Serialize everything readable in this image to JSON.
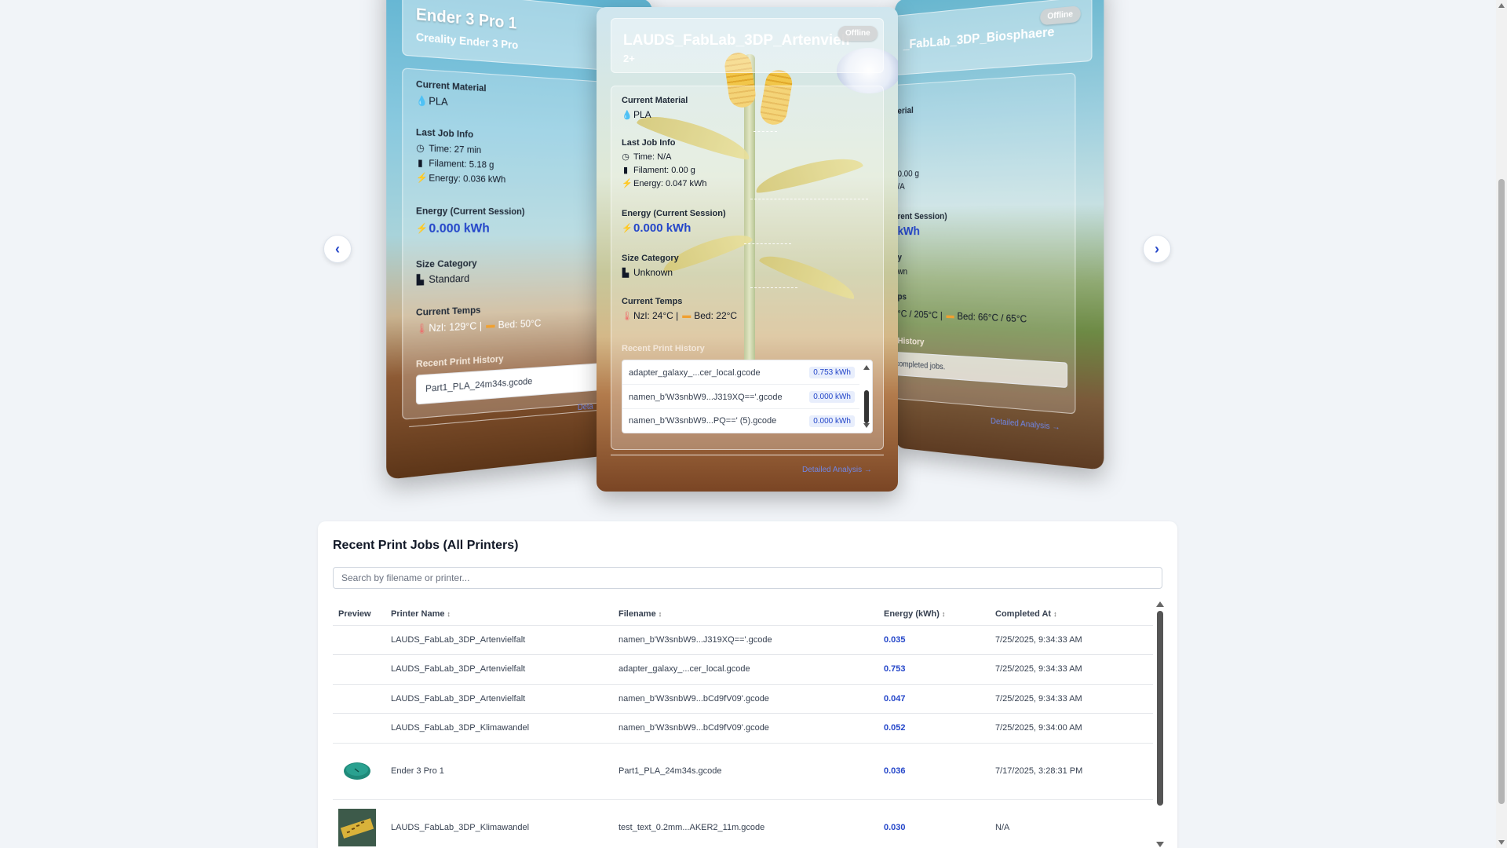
{
  "carousel": {
    "left_card": {
      "name": "Ender 3 Pro 1",
      "model": "Creality Ender 3 Pro",
      "material_label": "Current Material",
      "material": "PLA",
      "last_job_label": "Last Job Info",
      "time": "Time: 27 min",
      "filament": "Filament: 5.18 g",
      "energy": "Energy: 0.036 kWh",
      "session_label": "Energy (Current Session)",
      "session_value": "0.000 kWh",
      "size_label": "Size Category",
      "size": "Standard",
      "temps_label": "Current Temps",
      "nozzle": "Nzl: 129°C |",
      "bed": "Bed: 50°C",
      "history_label": "Recent Print History",
      "history_item": "Part1_PLA_24m34s.gcode",
      "details": "Deta"
    },
    "center_card": {
      "name": "LAUDS_FabLab_3DP_Artenvielfalt",
      "model": "2+",
      "status": "Offline",
      "material_label": "Current Material",
      "material": "PLA",
      "last_job_label": "Last Job Info",
      "time": "Time: N/A",
      "filament": "Filament: 0.00 g",
      "energy": "Energy: 0.047 kWh",
      "session_label": "Energy (Current Session)",
      "session_value": "0.000 kWh",
      "size_label": "Size Category",
      "size": "Unknown",
      "temps_label": "Current Temps",
      "nozzle": "Nzl: 24°C |",
      "bed": "Bed: 22°C",
      "history_label": "Recent Print History",
      "history": [
        {
          "file": "adapter_galaxy_...cer_local.gcode",
          "kwh": "0.753 kWh"
        },
        {
          "file": "namen_b'W3snbW9...J319XQ=='.gcode",
          "kwh": "0.000 kWh"
        },
        {
          "file": "namen_b'W3snbW9...PQ==' (5).gcode",
          "kwh": "0.000 kWh"
        }
      ],
      "details": "Detailed Analysis →"
    },
    "right_card": {
      "name": "_FabLab_3DP_Biosphaere",
      "status": "Offline",
      "material_label": "erial",
      "filament": "0.00 g",
      "energy": "/A",
      "session_label": "rent Session)",
      "session_value": "kWh",
      "size_label": "y",
      "size": "wn",
      "temps_label": "ps",
      "nozzle": "°C / 205°C |",
      "bed": "Bed: 66°C / 65°C",
      "history_label": "History",
      "history_item": "completed jobs.",
      "details": "Detailed Analysis →"
    },
    "prev_icon": "chevron-left-icon",
    "next_icon": "chevron-right-icon"
  },
  "jobs": {
    "title": "Recent Print Jobs (All Printers)",
    "search_placeholder": "Search by filename or printer...",
    "columns": {
      "preview": "Preview",
      "printer": "Printer Name",
      "filename": "Filename",
      "energy": "Energy (kWh)",
      "completed": "Completed At",
      "sort_glyph": "↕"
    },
    "rows": [
      {
        "preview": "none",
        "printer": "LAUDS_FabLab_3DP_Artenvielfalt",
        "filename": "namen_b'W3snbW9...J319XQ=='.gcode",
        "energy": "0.035",
        "completed": "7/25/2025, 9:34:33 AM"
      },
      {
        "preview": "none",
        "printer": "LAUDS_FabLab_3DP_Artenvielfalt",
        "filename": "adapter_galaxy_...cer_local.gcode",
        "energy": "0.753",
        "completed": "7/25/2025, 9:34:33 AM"
      },
      {
        "preview": "none",
        "printer": "LAUDS_FabLab_3DP_Artenvielfalt",
        "filename": "namen_b'W3snbW9...bCd9fV09'.gcode",
        "energy": "0.047",
        "completed": "7/25/2025, 9:34:33 AM"
      },
      {
        "preview": "none",
        "printer": "LAUDS_FabLab_3DP_Klimawandel",
        "filename": "namen_b'W3snbW9...bCd9fV09'.gcode",
        "energy": "0.052",
        "completed": "7/25/2025, 9:34:00 AM"
      },
      {
        "preview": "teal-disc",
        "printer": "Ender 3 Pro 1",
        "filename": "Part1_PLA_24m34s.gcode",
        "energy": "0.036",
        "completed": "7/17/2025, 3:28:31 PM"
      },
      {
        "preview": "text-plate",
        "printer": "LAUDS_FabLab_3DP_Klimawandel",
        "filename": "test_text_0.2mm...AKER2_11m.gcode",
        "energy": "0.030",
        "completed": "N/A"
      }
    ]
  },
  "colors": {
    "accent": "#2446c9",
    "page_bg": "#f1f4f8",
    "panel_bg": "#ffffff",
    "preview_teal": "#1f8a7a",
    "preview_plate": "#3d5a4a"
  }
}
